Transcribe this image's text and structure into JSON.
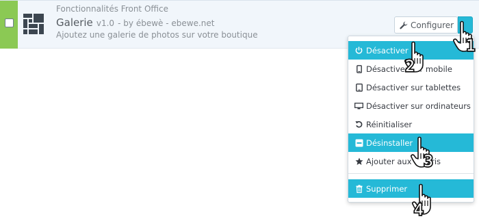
{
  "module": {
    "category": "Fonctionnalités Front Office",
    "name": "Galerie",
    "version": "v1.0",
    "author": "- by ébewè - ebewe.net",
    "description": "Ajoutez une galerie de photos sur votre boutique"
  },
  "actions": {
    "configure_label": "Configurer"
  },
  "dropdown": {
    "items": [
      {
        "label": "Désactiver",
        "icon": "power-icon"
      },
      {
        "label": "Désactiver sur mobile",
        "icon": "mobile-icon"
      },
      {
        "label": "Désactiver sur tablettes",
        "icon": "tablet-icon"
      },
      {
        "label": "Désactiver sur ordinateurs",
        "icon": "desktop-icon"
      },
      {
        "label": "Réinitialiser",
        "icon": "reset-icon"
      },
      {
        "label": "Désinstaller",
        "icon": "minus-icon"
      },
      {
        "label": "Ajouter aux favoris",
        "icon": "star-icon"
      },
      {
        "label": "Supprimer",
        "icon": "trash-icon"
      }
    ]
  },
  "annotations": {
    "step1": "1",
    "step2": "2",
    "step3": "3",
    "step4": "4"
  },
  "colors": {
    "accent": "#25b9d7",
    "enabled": "#8bc954"
  }
}
